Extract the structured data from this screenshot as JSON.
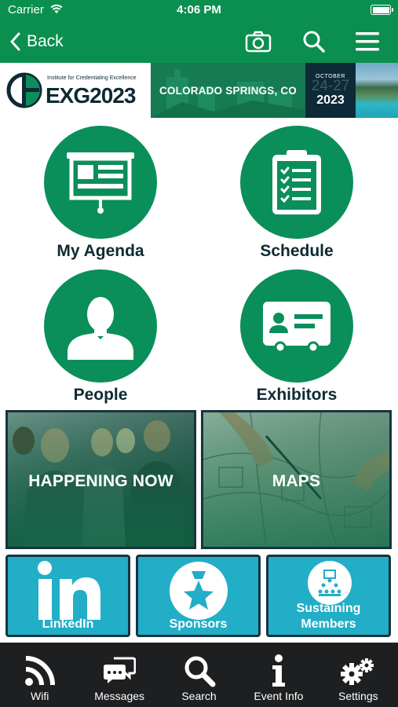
{
  "status_bar": {
    "carrier": "Carrier",
    "time": "4:06 PM"
  },
  "nav": {
    "back_label": "Back",
    "icons": [
      "camera-icon",
      "search-icon",
      "menu-icon"
    ]
  },
  "banner": {
    "org_name": "Institute for Credentialing Excellence",
    "event_logo_text": "EXG2023",
    "location": "COLORADO SPRINGS, CO",
    "month": "OCTOBER",
    "days": "24-27",
    "year": "2023"
  },
  "tiles": [
    {
      "label": "My Agenda",
      "icon": "presentation-board-icon"
    },
    {
      "label": "Schedule",
      "icon": "clipboard-checklist-icon"
    },
    {
      "label": "People",
      "icon": "person-silhouette-icon"
    },
    {
      "label": "Exhibitors",
      "icon": "id-card-icon"
    }
  ],
  "photo_tiles": [
    {
      "label": "HAPPENING NOW"
    },
    {
      "label": "MAPS"
    }
  ],
  "blue_tiles": [
    {
      "label": "LinkedIn",
      "icon": "linkedin-icon"
    },
    {
      "label": "Sponsors",
      "icon": "star-award-icon"
    },
    {
      "label": "Sustaining\nMembers",
      "line1": "Sustaining",
      "line2": "Members",
      "icon": "presenter-audience-icon"
    }
  ],
  "tabbar": [
    {
      "label": "Wifi",
      "icon": "rss-feed-icon"
    },
    {
      "label": "Messages",
      "icon": "chat-bubbles-icon"
    },
    {
      "label": "Search",
      "icon": "search-icon"
    },
    {
      "label": "Event Info",
      "icon": "info-icon"
    },
    {
      "label": "Settings",
      "icon": "gears-icon"
    }
  ],
  "colors": {
    "primary_green": "#0b8f4f",
    "tile_green": "#0b8f5a",
    "accent_blue": "#22aec6",
    "dark": "#18333f",
    "tabbar": "#1d1f21"
  }
}
